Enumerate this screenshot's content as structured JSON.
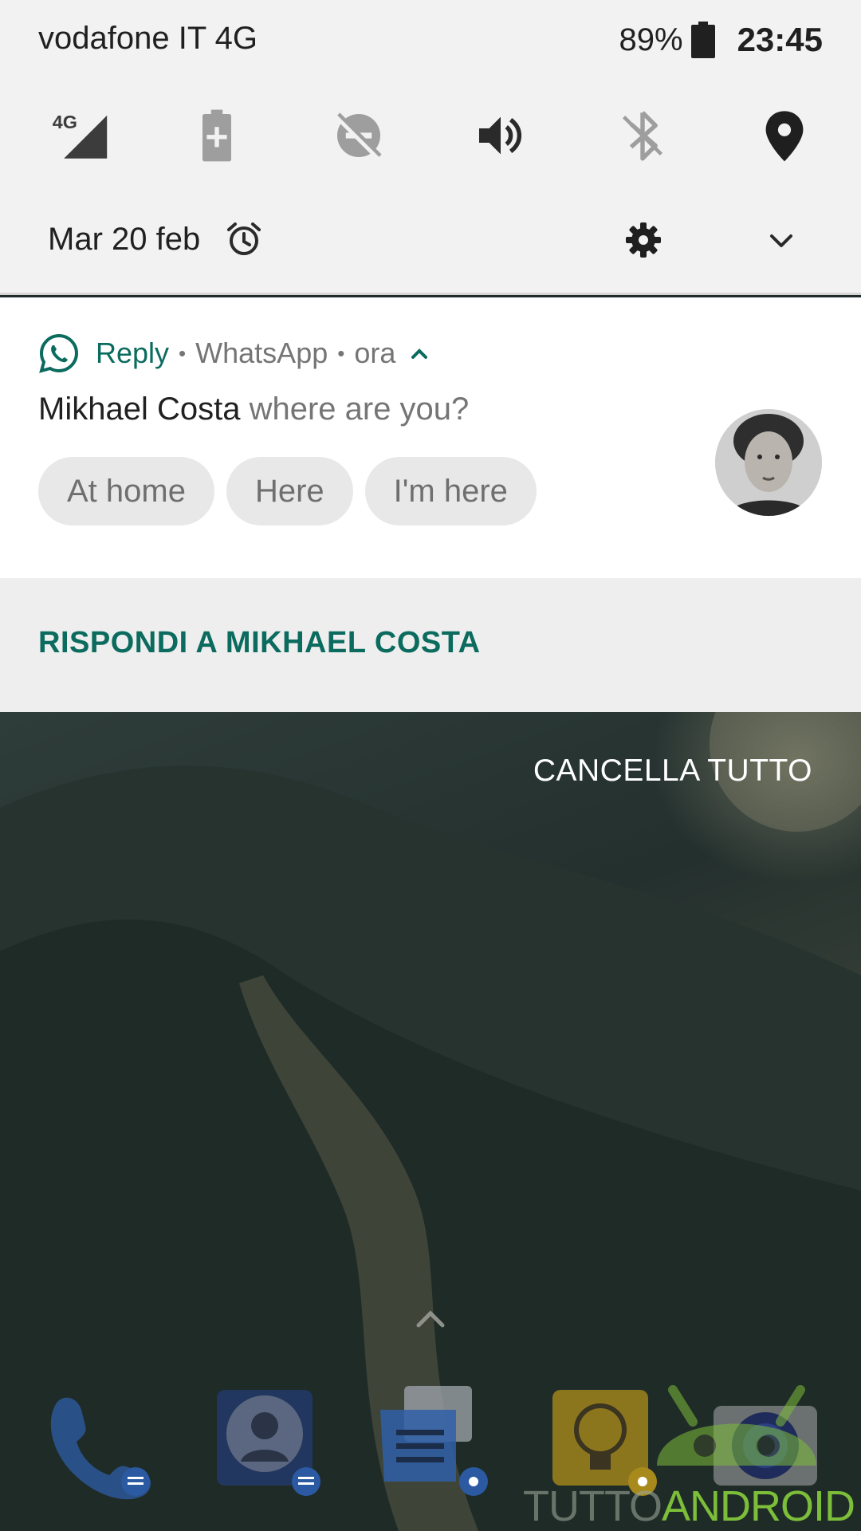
{
  "status_bar": {
    "carrier": "vodafone IT 4G",
    "battery_percent": "89%",
    "clock": "23:45"
  },
  "quick_settings": {
    "tiles": [
      {
        "icon": "signal-4g-icon",
        "label": "4G"
      },
      {
        "icon": "battery-saver-icon"
      },
      {
        "icon": "do-not-disturb-off-icon"
      },
      {
        "icon": "volume-icon"
      },
      {
        "icon": "bluetooth-off-icon"
      },
      {
        "icon": "location-icon"
      }
    ],
    "date": "Mar 20 feb",
    "icons": [
      "alarm-icon",
      "settings-icon",
      "chevron-down-icon"
    ]
  },
  "notification": {
    "app_label": "Reply",
    "app_name": "WhatsApp",
    "time": "ora",
    "sender": "Mikhael Costa",
    "message": "where are you?",
    "smart_replies": [
      "At home",
      "Here",
      "I'm here"
    ],
    "action": "RISPONDI A MIKHAEL COSTA",
    "accent_color": "#0b6b5e"
  },
  "home": {
    "clear_all": "CANCELLA TUTTO",
    "dock_icons": [
      "phone-icon",
      "contacts-icon",
      "messages-icon",
      "lightbulb-icon",
      "camera-icon"
    ],
    "watermark": {
      "prefix": "TUTTO",
      "brand": "ANDROID"
    }
  }
}
